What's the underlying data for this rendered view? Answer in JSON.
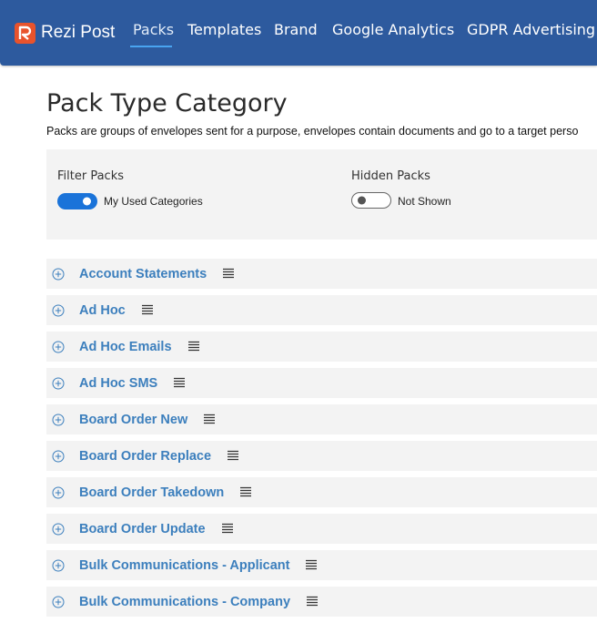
{
  "brand": {
    "name": "Rezi Post",
    "logo_letter": "R",
    "logo_color": "#e8532c"
  },
  "nav": {
    "items": [
      {
        "label": "Packs",
        "active": true
      },
      {
        "label": "Templates",
        "active": false
      },
      {
        "label": "Brand",
        "active": false
      },
      {
        "label": "Google Analytics",
        "active": false
      },
      {
        "label": "GDPR Advertising",
        "active": false
      }
    ],
    "background": "#2d5a9e"
  },
  "page": {
    "title": "Pack Type Category",
    "description": "Packs are groups of envelopes sent for a purpose, envelopes contain documents and go to a target perso"
  },
  "filters": {
    "filter_packs": {
      "label": "Filter Packs",
      "toggle_on": true,
      "toggle_text": "My Used Categories"
    },
    "hidden_packs": {
      "label": "Hidden Packs",
      "toggle_on": false,
      "toggle_text": "Not Shown"
    }
  },
  "categories": [
    {
      "name": "Account Statements"
    },
    {
      "name": "Ad Hoc"
    },
    {
      "name": "Ad Hoc Emails"
    },
    {
      "name": "Ad Hoc SMS"
    },
    {
      "name": "Board Order New"
    },
    {
      "name": "Board Order Replace"
    },
    {
      "name": "Board Order Takedown"
    },
    {
      "name": "Board Order Update"
    },
    {
      "name": "Bulk Communications - Applicant"
    },
    {
      "name": "Bulk Communications - Company"
    }
  ],
  "icons": {
    "expand": "circle-plus-icon",
    "menu": "list-menu-icon"
  },
  "colors": {
    "accent": "#1a73d9",
    "category_text": "#3c7fbd"
  }
}
